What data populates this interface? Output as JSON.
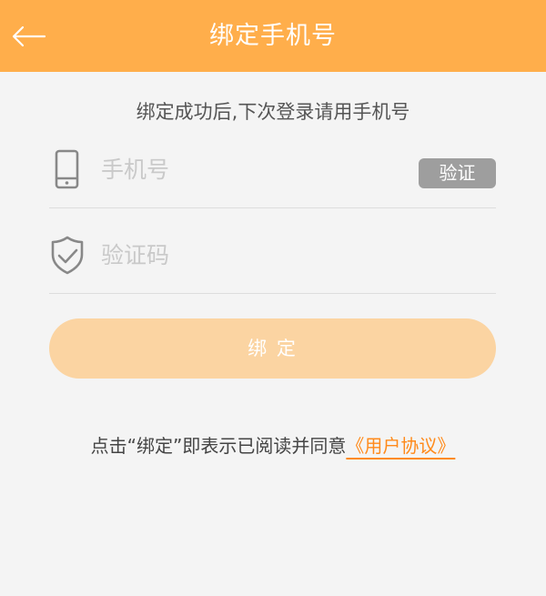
{
  "header": {
    "title": "绑定手机号",
    "back_icon": "arrow-left-icon",
    "background": "#ffae4b"
  },
  "subtitle": "绑定成功后,下次登录请用手机号",
  "phone_field": {
    "icon": "phone-icon",
    "placeholder": "手机号",
    "value": "",
    "verify_label": "验证"
  },
  "code_field": {
    "icon": "shield-check-icon",
    "placeholder": "验证码",
    "value": ""
  },
  "bind_button": {
    "label": "绑  定",
    "background": "#fbd4a2"
  },
  "agreement": {
    "text": "点击“绑定”即表示已阅读并同意",
    "link": "《用户协议》",
    "link_color": "#ff8a1a"
  }
}
